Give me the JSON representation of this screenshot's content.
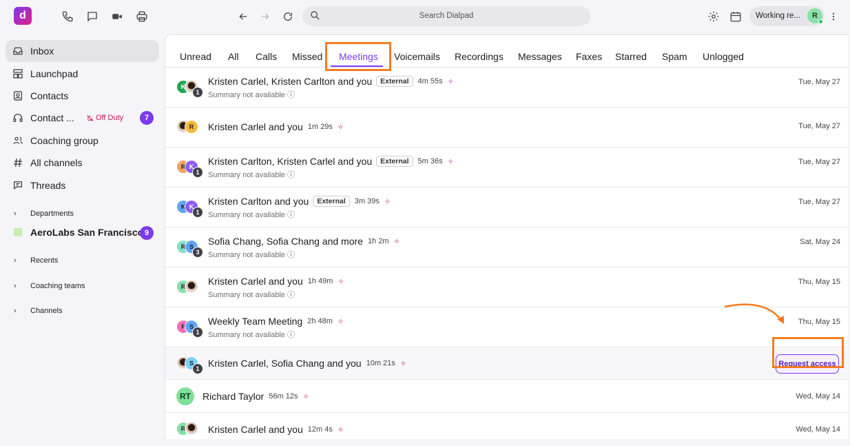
{
  "app": {
    "logo": "d"
  },
  "topbar": {
    "search_placeholder": "Search Dialpad",
    "status": "Working re...",
    "avatar_initial": "R",
    "icons": [
      "phone-icon",
      "chat-icon",
      "video-icon",
      "print-icon",
      "back-icon",
      "forward-icon",
      "refresh-icon",
      "search-icon",
      "settings-icon",
      "calendar-icon",
      "more-icon"
    ]
  },
  "sidebar": {
    "items": [
      {
        "label": "Inbox",
        "icon": "inbox-icon",
        "active": true
      },
      {
        "label": "Launchpad",
        "icon": "launchpad-icon"
      },
      {
        "label": "Contacts",
        "icon": "contacts-icon"
      },
      {
        "label": "Contact ...",
        "icon": "headset-icon",
        "status": "Off Duty",
        "badge": "7"
      },
      {
        "label": "Coaching group",
        "icon": "group-icon"
      },
      {
        "label": "All channels",
        "icon": "hash-icon"
      },
      {
        "label": "Threads",
        "icon": "threads-icon"
      }
    ],
    "sections": {
      "departments": "Departments",
      "dept_name": "AeroLabs San Francisco...",
      "dept_badge": "9",
      "recents": "Recents",
      "coaching_teams": "Coaching teams",
      "channels": "Channels"
    }
  },
  "tabs": [
    "Unread",
    "All",
    "Calls",
    "Missed",
    "Meetings",
    "Voicemails",
    "Recordings",
    "Messages",
    "Faxes",
    "Starred",
    "Spam",
    "Unlogged"
  ],
  "active_tab": "Meetings",
  "rows": [
    {
      "title": "Kristen Carlel, Kristen Carlton and you",
      "external": "External",
      "duration": "4m 55s",
      "subtitle": "Summary not available",
      "date": "Tue, May 27",
      "count": "1",
      "a1": "K"
    },
    {
      "title": "Kristen Carlel and you",
      "duration": "1m 29s",
      "date": "Tue, May 27",
      "a2": "R"
    },
    {
      "title": "Kristen Carlton, Kristen Carlel and you",
      "external": "External",
      "duration": "5m 36s",
      "subtitle": "Summary not available",
      "date": "Tue, May 27",
      "count": "1",
      "a1": "R",
      "a2": "K"
    },
    {
      "title": "Kristen Carlton and you",
      "external": "External",
      "duration": "3m 39s",
      "subtitle": "Summary not available",
      "date": "Tue, May 27",
      "count": "1",
      "a1": "K",
      "a2": "K"
    },
    {
      "title": "Sofia Chang, Sofia Chang and more",
      "duration": "1h 2m",
      "subtitle": "Summary not available",
      "date": "Sat, May 24",
      "count": "3",
      "a1": "R",
      "a2": "S"
    },
    {
      "title": "Kristen Carlel and you",
      "duration": "1h 49m",
      "subtitle": "Summary not available",
      "date": "Thu, May 15",
      "a1": "R"
    },
    {
      "title": "Weekly Team Meeting",
      "duration": "2h 48m",
      "subtitle": "Summary not available",
      "date": "Thu, May 15",
      "count": "1",
      "a1": "F",
      "a2": "S"
    },
    {
      "title": "Kristen Carlel, Sofia Chang and you",
      "duration": "10m 21s",
      "button": "Request access",
      "count": "1",
      "a2": "S"
    },
    {
      "title": "Richard Taylor",
      "duration": "56m 12s",
      "date": "Wed, May 14",
      "initials": "RT"
    },
    {
      "title": "Kristen Carlel and you",
      "duration": "12m 4s",
      "date": "Wed, May 14",
      "a1": "R"
    }
  ],
  "colors": {
    "accent": "#7c3aed",
    "highlight": "#f47c20",
    "sparkle": "#d02f8a"
  }
}
